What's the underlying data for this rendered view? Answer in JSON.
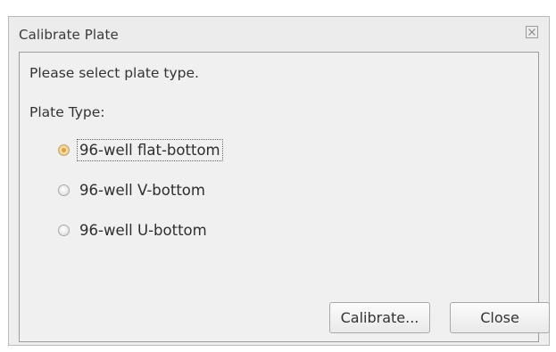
{
  "dialog": {
    "title": "Calibrate Plate",
    "close_icon": "close-x-icon"
  },
  "content": {
    "instruction": "Please select plate type.",
    "plate_type_label": "Plate Type:",
    "options": [
      {
        "label": "96-well flat-bottom",
        "selected": true
      },
      {
        "label": "96-well V-bottom",
        "selected": false
      },
      {
        "label": "96-well U-bottom",
        "selected": false
      }
    ]
  },
  "buttons": {
    "calibrate_label": "Calibrate...",
    "close_label": "Close"
  },
  "colors": {
    "selected_radio": "#dcb25c",
    "dialog_background": "#eeeeee"
  }
}
